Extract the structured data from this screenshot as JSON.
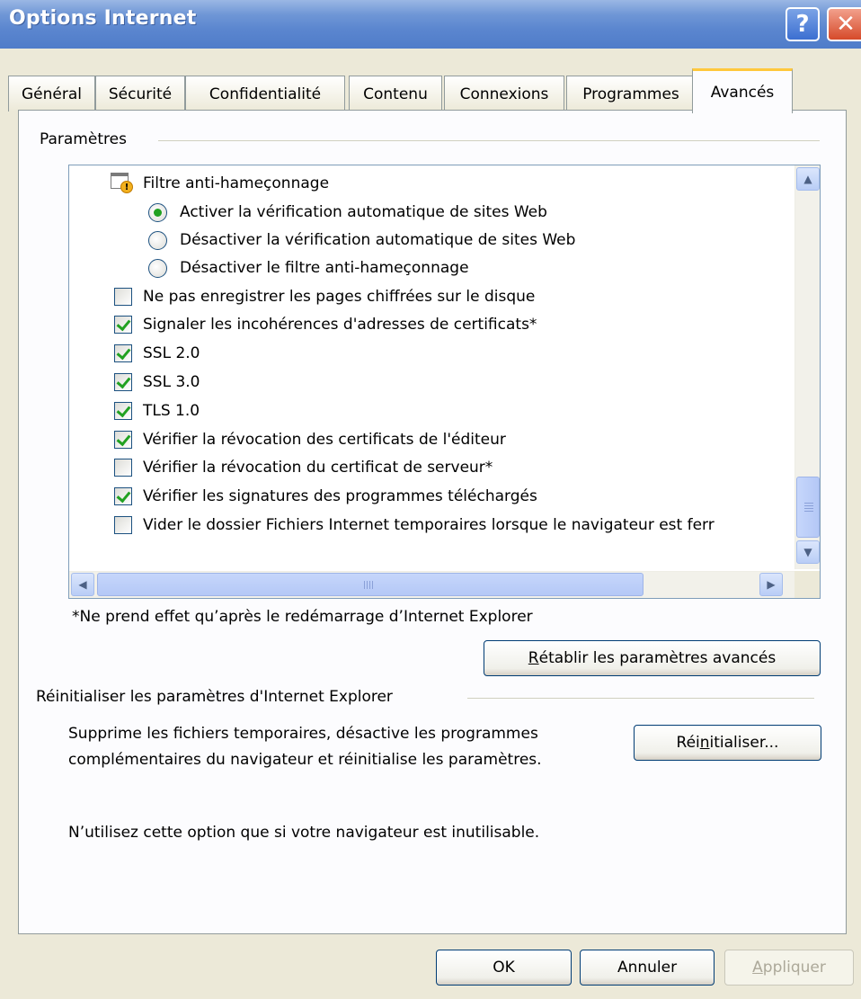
{
  "window": {
    "title": "Options Internet",
    "help_glyph": "?",
    "close_glyph": "✕"
  },
  "tabs": [
    {
      "label": "Général"
    },
    {
      "label": "Sécurité"
    },
    {
      "label": "Confidentialité"
    },
    {
      "label": "Contenu"
    },
    {
      "label": "Connexions"
    },
    {
      "label": "Programmes"
    },
    {
      "label": "Avancés",
      "active": true
    }
  ],
  "settings": {
    "group_label": "Paramètres",
    "items": [
      {
        "type": "category",
        "label": "Filtre anti-hameçonnage",
        "icon": "security-settings-icon"
      },
      {
        "type": "radio",
        "label": "Activer la vérification automatique de sites Web",
        "checked": true
      },
      {
        "type": "radio",
        "label": "Désactiver la vérification automatique de sites Web",
        "checked": false
      },
      {
        "type": "radio",
        "label": "Désactiver le filtre anti-hameçonnage",
        "checked": false
      },
      {
        "type": "checkbox",
        "label": "Ne pas enregistrer les pages chiffrées sur le disque",
        "checked": false
      },
      {
        "type": "checkbox",
        "label": "Signaler les incohérences d'adresses de certificats*",
        "checked": true
      },
      {
        "type": "checkbox",
        "label": "SSL 2.0",
        "checked": true
      },
      {
        "type": "checkbox",
        "label": "SSL 3.0",
        "checked": true
      },
      {
        "type": "checkbox",
        "label": "TLS 1.0",
        "checked": true
      },
      {
        "type": "checkbox",
        "label": "Vérifier la révocation des certificats de l'éditeur",
        "checked": true
      },
      {
        "type": "checkbox",
        "label": "Vérifier la révocation du certificat de serveur*",
        "checked": false
      },
      {
        "type": "checkbox",
        "label": "Vérifier les signatures des programmes téléchargés",
        "checked": true
      },
      {
        "type": "checkbox",
        "label": "Vider le dossier Fichiers Internet temporaires lorsque le navigateur est ferr",
        "checked": false
      }
    ],
    "footnote": "*Ne prend effet qu’après le redémarrage d’Internet Explorer",
    "restore_button_pre": "",
    "restore_button_accel": "R",
    "restore_button_post": "établir les paramètres avancés"
  },
  "reset": {
    "group_label": "Réinitialiser les paramètres d'Internet Explorer",
    "desc_line1": "Supprime les fichiers temporaires, désactive les programmes",
    "desc_line2": "complémentaires du navigateur et réinitialise les paramètres.",
    "button_pre": "Réi",
    "button_accel": "n",
    "button_post": "itialiser...",
    "warning": "N’utilisez cette option que si votre navigateur est inutilisable."
  },
  "footer": {
    "ok": "OK",
    "cancel": "Annuler",
    "apply_accel": "A",
    "apply_post": "ppliquer"
  }
}
